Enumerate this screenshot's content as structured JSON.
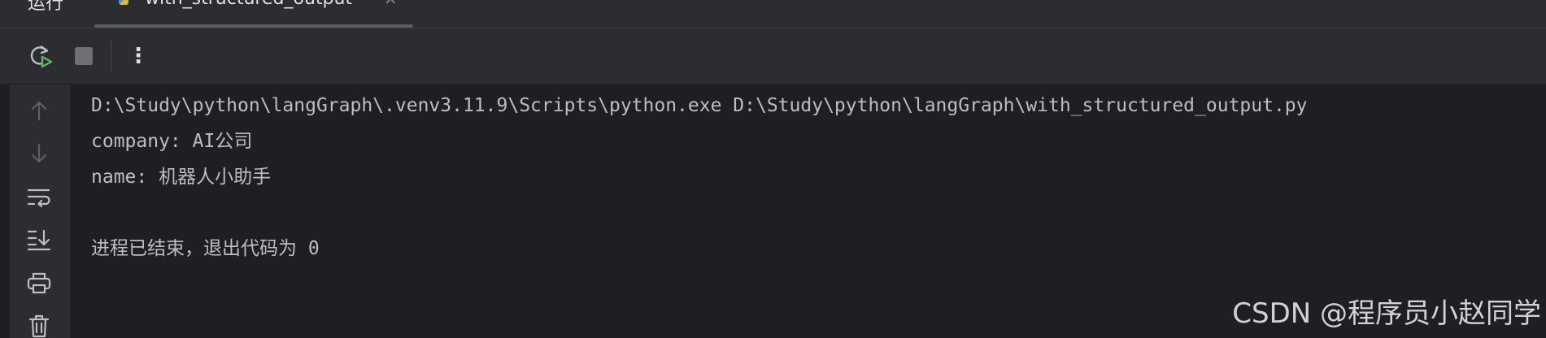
{
  "panel": {
    "title": "运行"
  },
  "tab": {
    "label": "with_structured_output",
    "close": "×"
  },
  "toolbar": {
    "more_label": "⋮"
  },
  "console": {
    "lines": [
      "D:\\Study\\python\\langGraph\\.venv3.11.9\\Scripts\\python.exe D:\\Study\\python\\langGraph\\with_structured_output.py",
      "company: AI公司",
      "name: 机器人小助手",
      "",
      "进程已结束，退出代码为 0"
    ]
  },
  "watermark": "CSDN @程序员小赵同学",
  "colors": {
    "background": "#1e1f22",
    "toolbar": "#2b2d30",
    "text": "#bcbec4",
    "rerun_green": "#5fb865"
  }
}
